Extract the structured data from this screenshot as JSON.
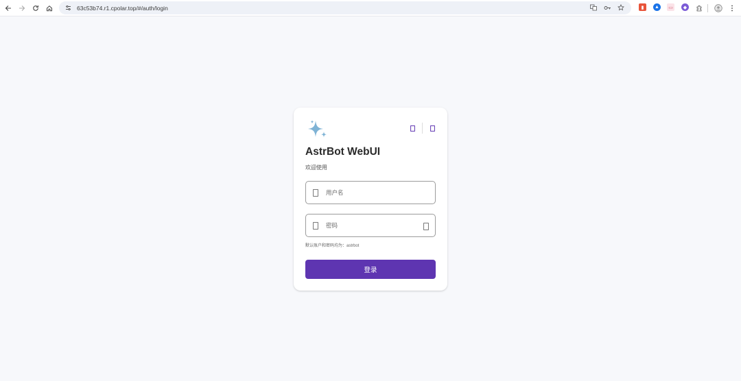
{
  "browser": {
    "url": "63c53b74.r1.cpolar.top/#/auth/login",
    "icons": [
      "back-icon",
      "forward-icon",
      "reload-icon",
      "home-icon",
      "site-settings-icon",
      "translate-icon",
      "password-key-icon",
      "bookmark-star-icon",
      "extensions-icon",
      "profile-icon",
      "menu-icon"
    ],
    "extension_colors": [
      "#e8543a",
      "#1a73e8",
      "#f3a7b5",
      "#7b5bd6"
    ]
  },
  "card": {
    "logo": "sparkle-icon",
    "logo_color": "#7fb3d5",
    "top_icons": [
      "theme-toggle-icon",
      "language-icon"
    ],
    "title": "AstrBot WebUI",
    "subtitle": "欢迎使用",
    "username": {
      "icon": "user-icon",
      "placeholder": "用户名",
      "value": ""
    },
    "password": {
      "icon": "lock-icon",
      "placeholder": "密码",
      "value": "",
      "toggle_icon": "eye-icon"
    },
    "hint": "默认账户和密码均为：astrbot",
    "login_label": "登录",
    "accent": "#5e35b1"
  }
}
